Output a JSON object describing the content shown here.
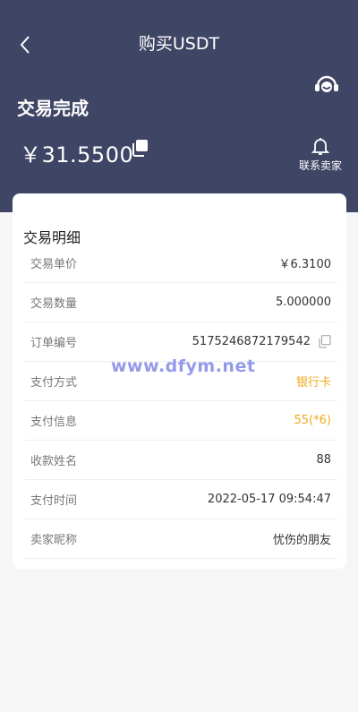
{
  "header": {
    "title": "购买USDT",
    "status": "交易完成",
    "amount": "￥31.5500",
    "contact_label": "联系卖家"
  },
  "icons": {
    "back": "chevron-left-icon",
    "support": "customer-service-icon",
    "copy": "copy-icon",
    "bell": "bell-icon"
  },
  "details": {
    "title": "交易明细",
    "rows": [
      {
        "label": "交易单价",
        "value": "￥6.3100"
      },
      {
        "label": "交易数量",
        "value": "5.000000"
      },
      {
        "label": "订单编号",
        "value": "5175246872179542"
      },
      {
        "label": "支付方式",
        "value": "银行卡"
      },
      {
        "label": "支付信息",
        "value": "55(*6)"
      },
      {
        "label": "收款姓名",
        "value": "88"
      },
      {
        "label": "支付时间",
        "value": "2022-05-17 09:54:47"
      },
      {
        "label": "卖家昵称",
        "value": "忧伤的朋友"
      }
    ]
  },
  "watermark": "www.dfym.net",
  "colors": {
    "header_bg": "#3f4564",
    "accent": "#f0a81b",
    "page_bg": "#f6f6f7"
  }
}
